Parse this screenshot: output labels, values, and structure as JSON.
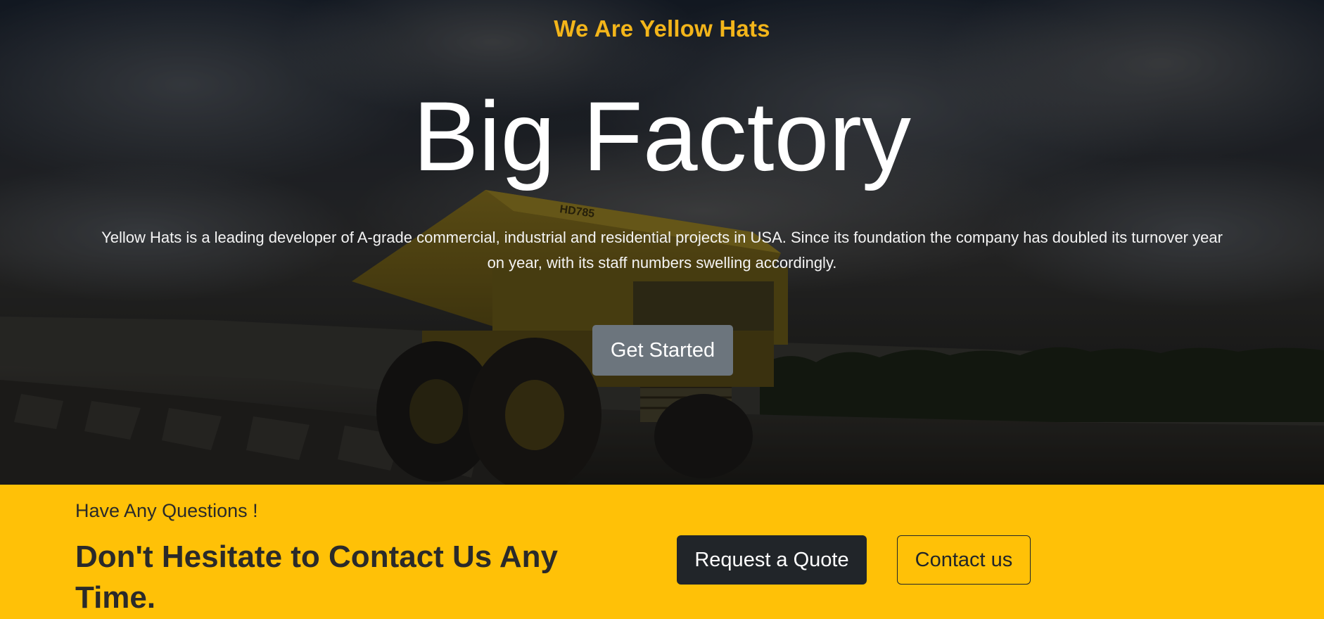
{
  "hero": {
    "eyebrow": "We Are Yellow Hats",
    "title": "Big Factory",
    "description": "Yellow Hats is a leading developer of A-grade commercial, industrial and residential projects in USA. Since its foundation the company has doubled its turnover year on year, with its staff numbers swelling accordingly.",
    "cta_label": "Get Started",
    "truck_label": "HD785"
  },
  "contact_band": {
    "subheading": "Have Any Questions !",
    "heading": "Don't Hesitate to Contact Us Any Time.",
    "quote_button": "Request a Quote",
    "contact_button": "Contact us"
  },
  "colors": {
    "accent": "#ffc107",
    "eyebrow": "#f3b51a",
    "dark_button": "#212529",
    "secondary_button": "#6c757d"
  }
}
